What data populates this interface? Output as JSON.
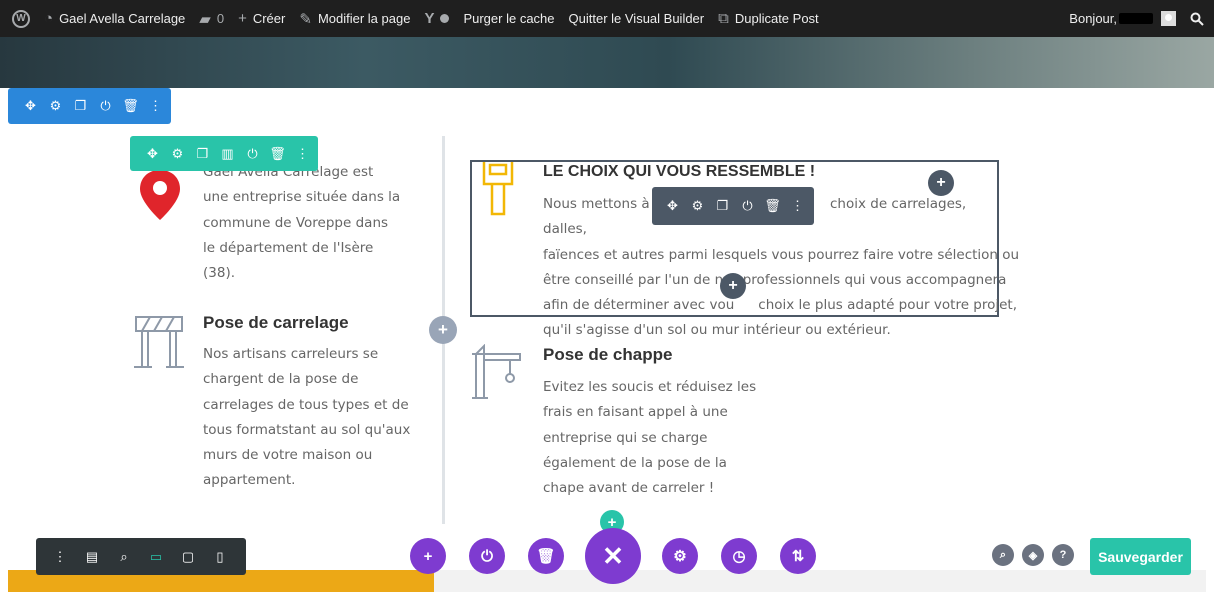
{
  "adminbar": {
    "site_name": "Gael Avella Carrelage",
    "comments_count": "0",
    "create": "Créer",
    "edit_page": "Modifier la page",
    "purge_cache": "Purger le cache",
    "quit_builder": "Quitter le Visual Builder",
    "duplicate_post": "Duplicate Post",
    "greeting": "Bonjour,"
  },
  "left_column": {
    "blurb1_text_lines": [
      "Gael Avella Carrelage est",
      "une entreprise située dans la",
      "commune de Voreppe dans",
      "le département de l'Isère",
      "(38)."
    ],
    "blurb2_title": "Pose de carrelage",
    "blurb2_text_lines": [
      "Nos artisans carreleurs se",
      "chargent de la pose de",
      "carrelages de tous types et de",
      "tous formatstant au sol qu'aux",
      "murs de votre maison ou",
      "appartement."
    ]
  },
  "right_column": {
    "blurb1_title": "LE CHOIX QUI VOUS RESSEMBLE !",
    "blurb1_text_lines": [
      "Nous mettons à v",
      "choix de carrelages, dalles,",
      "faïences et autres parmi lesquels vous pourrez faire votre sélection ou",
      "être conseillé par l'un de nos professionnels qui vous accompagnera",
      "afin de déterminer avec vou",
      "choix le plus adapté pour votre projet,",
      "qu'il s'agisse d'un sol ou mur intérieur ou extérieur."
    ],
    "blurb2_title": "Pose de chappe",
    "blurb2_text_lines": [
      "Evitez les soucis et réduisez les",
      "frais en faisant appel à une",
      "entreprise qui se charge",
      "également de la pose de la",
      "chape avant de carreler !"
    ]
  },
  "builder": {
    "save_label": "Sauvegarder",
    "plus_glyph": "+",
    "close_glyph": "✕"
  },
  "colors": {
    "section_toolbar": "#2b87da",
    "row_toolbar": "#29c4a9",
    "module_toolbar": "#4c5866",
    "builder_purple": "#7e3bd0",
    "pin_red": "#e0252b",
    "brush_yellow": "#f2b705",
    "accent_band": "#eca816"
  },
  "icons": {
    "toolbar": [
      "move-icon",
      "settings-icon",
      "duplicate-icon",
      "columns-icon",
      "power-icon",
      "delete-icon",
      "more-icon"
    ],
    "view_bar": [
      "more-icon",
      "wireframe-icon",
      "zoom-icon",
      "desktop-icon",
      "tablet-icon",
      "phone-icon"
    ],
    "bottom_center": [
      "add-icon",
      "power-icon",
      "delete-icon",
      "close-icon",
      "settings-icon",
      "history-icon",
      "portability-icon"
    ],
    "bottom_right": [
      "search-icon",
      "layers-icon",
      "help-icon"
    ]
  }
}
